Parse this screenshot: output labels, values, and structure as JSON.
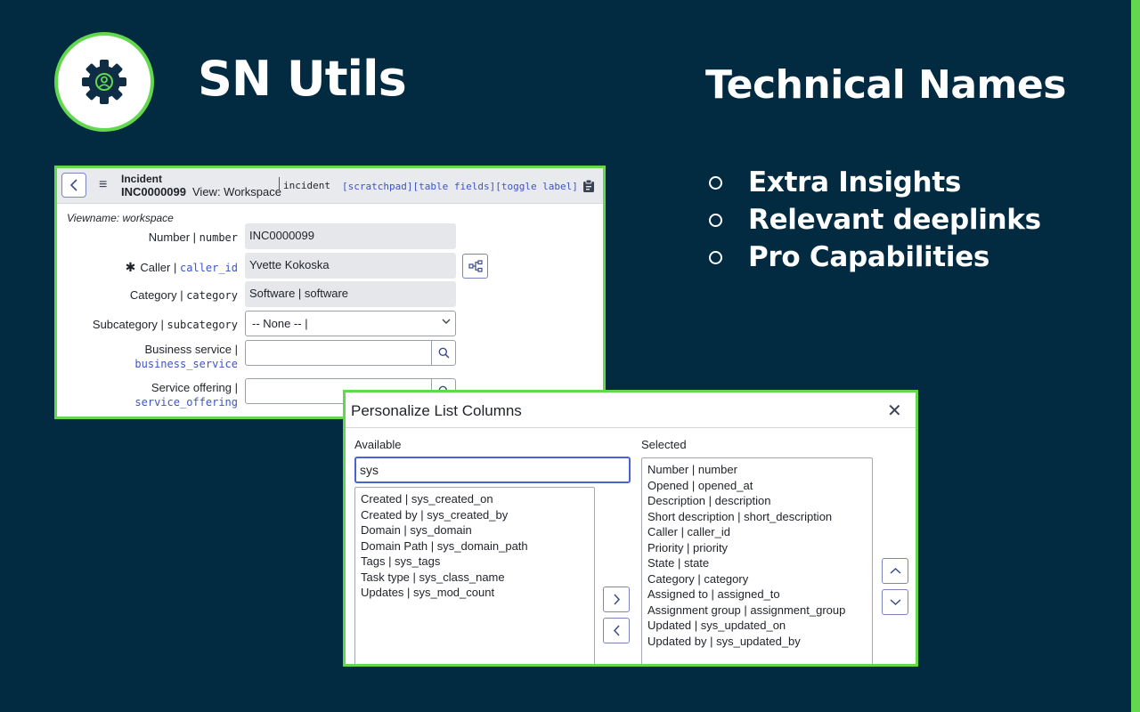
{
  "brand": {
    "title": "SN Utils"
  },
  "feature": {
    "title": "Technical Names",
    "bullets": [
      "Extra Insights",
      "Relevant deeplinks",
      "Pro Capabilities"
    ]
  },
  "colors": {
    "background": "#022b41",
    "accent": "#62d84e",
    "link": "#3b55c6"
  },
  "form": {
    "header": {
      "record_type": "Incident",
      "number": "INC0000099",
      "view": "View: Workspace",
      "table": "incident",
      "links": [
        "[scratchpad]",
        "[table fields]",
        "[toggle label]"
      ]
    },
    "viewname": "Viewname: workspace",
    "fields": {
      "number": {
        "label": "Number",
        "tech": "number",
        "value": "INC0000099"
      },
      "caller": {
        "label": "Caller",
        "tech": "caller_id",
        "value": "Yvette Kokoska"
      },
      "category": {
        "label": "Category",
        "tech": "category",
        "value": "Software | software"
      },
      "subcategory": {
        "label": "Subcategory",
        "tech": "subcategory",
        "value": "-- None -- |"
      },
      "business_service": {
        "label": "Business service",
        "tech": "business_service",
        "value": ""
      },
      "service_offering": {
        "label": "Service offering",
        "tech": "service_offering",
        "value": ""
      }
    }
  },
  "dialog": {
    "title": "Personalize List Columns",
    "available_label": "Available",
    "selected_label": "Selected",
    "search_value": "sys",
    "available": [
      "Created | sys_created_on",
      "Created by | sys_created_by",
      "Domain | sys_domain",
      "Domain Path | sys_domain_path",
      "Tags | sys_tags",
      "Task type | sys_class_name",
      "Updates | sys_mod_count"
    ],
    "selected": [
      "Number | number",
      "Opened | opened_at",
      "Description | description",
      "Short description | short_description",
      "Caller | caller_id",
      "Priority | priority",
      "State | state",
      "Category | category",
      "Assigned to | assigned_to",
      "Assignment group | assignment_group",
      "Updated | sys_updated_on",
      "Updated by | sys_updated_by"
    ]
  }
}
